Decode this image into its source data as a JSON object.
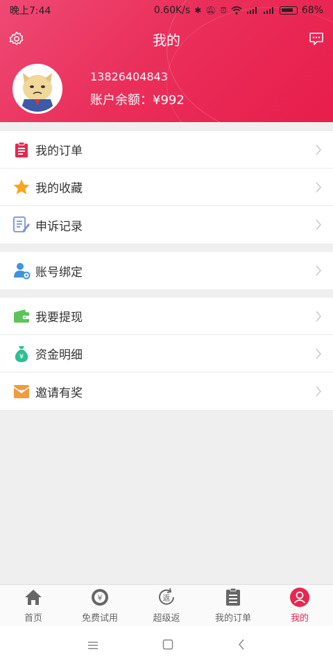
{
  "status_bar": {
    "time": "晚上7:44",
    "speed": "0.60K/s",
    "battery": "68%"
  },
  "header": {
    "title": "我的",
    "phone": "13826404843",
    "balance": "账户余额：¥992"
  },
  "menu_groups": [
    [
      {
        "label": "我的订单",
        "icon": "clipboard-icon"
      },
      {
        "label": "我的收藏",
        "icon": "star-icon"
      },
      {
        "label": "申诉记录",
        "icon": "edit-document-icon"
      }
    ],
    [
      {
        "label": "账号绑定",
        "icon": "user-settings-icon"
      }
    ],
    [
      {
        "label": "我要提现",
        "icon": "wallet-icon"
      },
      {
        "label": "资金明细",
        "icon": "money-bag-icon"
      },
      {
        "label": "邀请有奖",
        "icon": "envelope-heart-icon"
      }
    ]
  ],
  "tabbar": {
    "items": [
      {
        "label": "首页",
        "icon": "home-icon"
      },
      {
        "label": "免费试用",
        "icon": "yuan-cycle-icon"
      },
      {
        "label": "超级返",
        "icon": "return-icon"
      },
      {
        "label": "我的订单",
        "icon": "clipboard-icon"
      },
      {
        "label": "我的",
        "icon": "person-icon"
      }
    ],
    "active_index": 4
  },
  "colors": {
    "brand": "#e8264f",
    "order_red": "#e8264f",
    "star_orange": "#f7a51c",
    "doc_blue": "#7b8fd8",
    "user_blue": "#3e94e0",
    "wallet_green": "#5cc45a",
    "bag_green": "#2fbf8f",
    "envelope_orange": "#f39a3c"
  }
}
